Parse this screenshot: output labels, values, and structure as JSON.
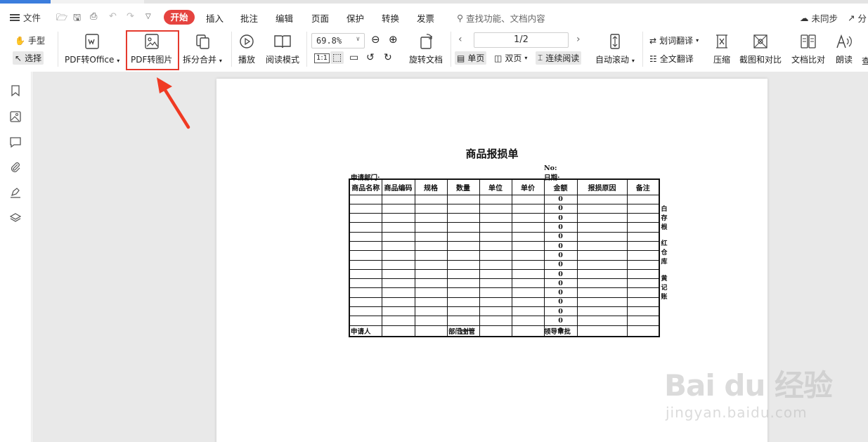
{
  "menubar": {
    "file": "文件",
    "tabs": [
      "开始",
      "插入",
      "批注",
      "编辑",
      "页面",
      "保护",
      "转换",
      "发票"
    ],
    "search_placeholder": "查找功能、文档内容",
    "sync": "未同步",
    "share": "分"
  },
  "toolbar": {
    "hand": "手型",
    "select": "选择",
    "pdf_to_office": "PDF转Office",
    "pdf_to_image": "PDF转图片",
    "split_merge": "拆分合并",
    "play": "播放",
    "read_mode": "阅读模式",
    "zoom": "69.8%",
    "rotate_doc": "旋转文档",
    "page_indicator": "1/2",
    "single_page": "单页",
    "double_page": "双页",
    "continuous": "连续阅读",
    "auto_scroll": "自动滚动",
    "word_translate": "划词翻译",
    "full_translate": "全文翻译",
    "compress": "压缩",
    "screenshot_compare": "截图和对比",
    "doc_compare": "文档比对",
    "read_aloud": "朗读",
    "more": "查"
  },
  "document": {
    "title": "商品报损单",
    "no_label": "No:",
    "dept_label": "申请部门:",
    "date_label": "日期:",
    "columns": [
      "商品名称",
      "商品编码",
      "规格",
      "数量",
      "单位",
      "单价",
      "金额",
      "报损原因",
      "备注"
    ],
    "row_amounts": [
      "0",
      "0",
      "0",
      "0",
      "0",
      "0",
      "0",
      "0",
      "0",
      "0",
      "0",
      "0",
      "0",
      "0"
    ],
    "total_label": "合计",
    "total_amount": "0",
    "applicant": "申请人",
    "dept_head": "部门主管",
    "leader": "领导审批",
    "side_notes": [
      "白",
      "存",
      "根",
      "红",
      "仓",
      "库",
      "黄",
      "记",
      "账"
    ]
  },
  "watermark": {
    "main": "Bai du 经验",
    "sub": "jingyan.baidu.com"
  }
}
